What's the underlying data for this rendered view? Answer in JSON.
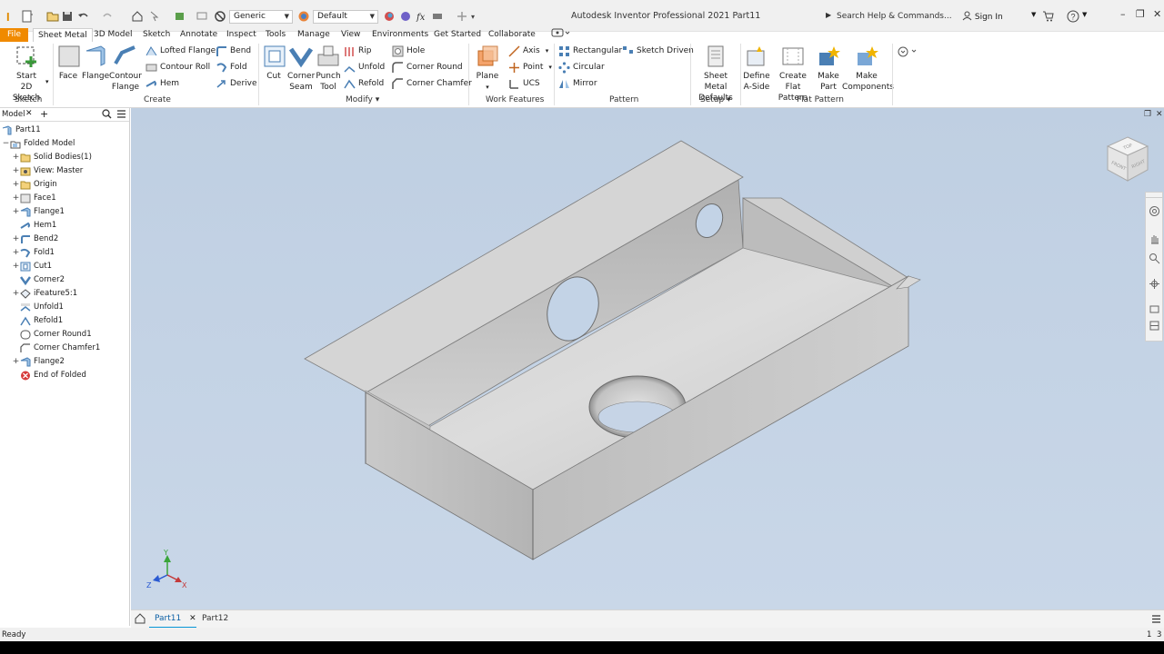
{
  "titlebar": {
    "app_title": "Autodesk Inventor Professional 2021    Part11",
    "material_combo": "Generic",
    "appearance_combo": "Default",
    "search_placeholder": "Search Help & Commands...",
    "signin_label": "Sign In"
  },
  "tabs": [
    "File",
    "Sheet Metal",
    "3D Model",
    "Sketch",
    "Annotate",
    "Inspect",
    "Tools",
    "Manage",
    "View",
    "Environments",
    "Get Started",
    "Collaborate"
  ],
  "ribbon": {
    "sketch": {
      "start_line1": "Start",
      "start_line2": "2D Sketch",
      "group": "Sketch"
    },
    "create": {
      "face": "Face",
      "flange": "Flange",
      "contour_line1": "Contour",
      "contour_line2": "Flange",
      "lofted_flange": "Lofted Flange",
      "contour_roll": "Contour Roll",
      "hem": "Hem",
      "bend": "Bend",
      "fold": "Fold",
      "derive": "Derive",
      "group": "Create"
    },
    "modify": {
      "cut": "Cut",
      "corner_seam_line1": "Corner",
      "corner_seam_line2": "Seam",
      "punch_line1": "Punch",
      "punch_line2": "Tool",
      "rip": "Rip",
      "unfold": "Unfold",
      "refold": "Refold",
      "hole": "Hole",
      "corner_round": "Corner Round",
      "corner_chamfer": "Corner Chamfer",
      "group": "Modify"
    },
    "work_features": {
      "plane": "Plane",
      "axis": "Axis",
      "point": "Point",
      "ucs": "UCS",
      "group": "Work Features"
    },
    "pattern": {
      "rectangular": "Rectangular",
      "circular": "Circular",
      "mirror": "Mirror",
      "sketch_driven": "Sketch Driven",
      "group": "Pattern"
    },
    "setup": {
      "defaults_line1": "Sheet Metal",
      "defaults_line2": "Defaults",
      "group": "Setup"
    },
    "flat_pattern": {
      "define_line1": "Define",
      "define_line2": "A-Side",
      "create_line1": "Create",
      "create_line2": "Flat Pattern",
      "make_part_line1": "Make",
      "make_part_line2": "Part",
      "make_comp_line1": "Make",
      "make_comp_line2": "Components",
      "group": "Flat Pattern"
    }
  },
  "browser": {
    "tab_label": "Model",
    "root": "Part11",
    "items": [
      {
        "label": "Folded Model"
      },
      {
        "label": "Solid Bodies(1)"
      },
      {
        "label": "View: Master"
      },
      {
        "label": "Origin"
      },
      {
        "label": "Face1"
      },
      {
        "label": "Flange1"
      },
      {
        "label": "Hem1"
      },
      {
        "label": "Bend2"
      },
      {
        "label": "Fold1"
      },
      {
        "label": "Cut1"
      },
      {
        "label": "Corner2"
      },
      {
        "label": "iFeature5:1"
      },
      {
        "label": "Unfold1"
      },
      {
        "label": "Refold1"
      },
      {
        "label": "Corner Round1"
      },
      {
        "label": "Corner Chamfer1"
      },
      {
        "label": "Flange2"
      },
      {
        "label": "End of Folded"
      }
    ]
  },
  "viewcube": {
    "top": "TOP",
    "front": "FRONT",
    "right": "RIGHT"
  },
  "axes": {
    "x": "X",
    "y": "Y",
    "z": "Z"
  },
  "doc_tabs": [
    "Part11",
    "Part12"
  ],
  "status": {
    "text": "Ready",
    "count_a": "1",
    "count_b": "3"
  },
  "colors": {
    "file_tab": "#f08a00",
    "accent": "#0696d7",
    "viewport_top": "#bfcfe2",
    "viewport_bottom": "#c9d7e8",
    "part_gray": "#b7b7b7"
  }
}
